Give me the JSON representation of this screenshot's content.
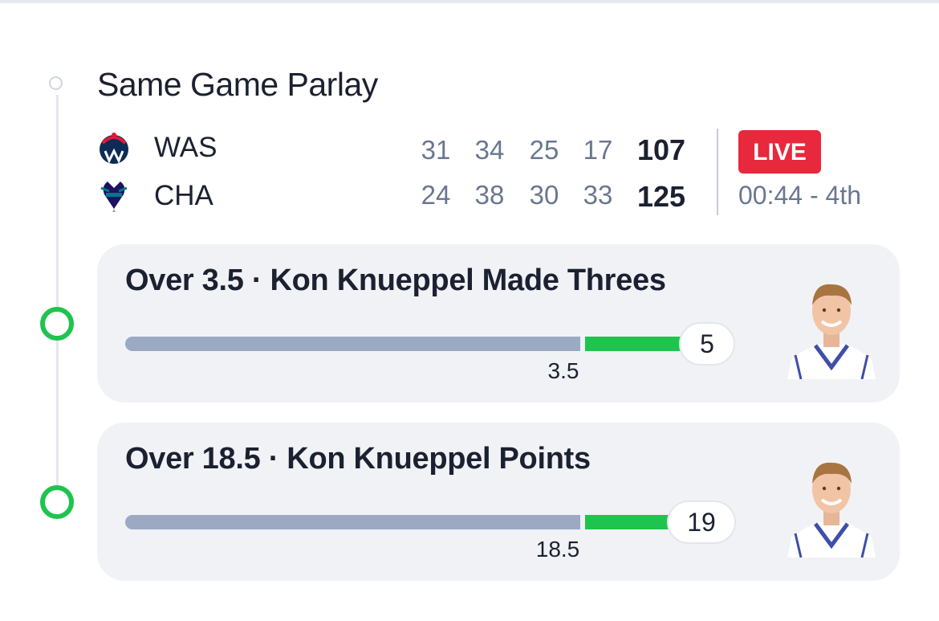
{
  "title": "Same Game Parlay",
  "game": {
    "teams": [
      {
        "abbr": "WAS",
        "logo": "wizards-logo",
        "quarters": [
          "31",
          "34",
          "25",
          "17"
        ],
        "total": "107"
      },
      {
        "abbr": "CHA",
        "logo": "hornets-logo",
        "quarters": [
          "24",
          "38",
          "30",
          "33"
        ],
        "total": "125"
      }
    ],
    "status": "LIVE",
    "clock": "00:44 - 4th"
  },
  "legs": [
    {
      "title": "Over 3.5 · Kon Knueppel Made Threes",
      "line": "3.5",
      "actual": "5",
      "progress_fraction": 1.0,
      "status_icon": "green-ring-icon",
      "avatar": "player-headshot"
    },
    {
      "title": "Over 18.5 · Kon Knueppel Points",
      "line": "18.5",
      "actual": "19",
      "progress_fraction": 1.0,
      "status_icon": "green-ring-icon",
      "avatar": "player-headshot"
    }
  ],
  "colors": {
    "accent_green": "#1ec44e",
    "live_red": "#e8283c",
    "bar_gray": "#9ba9c3",
    "card_bg": "#f0f2f6"
  }
}
